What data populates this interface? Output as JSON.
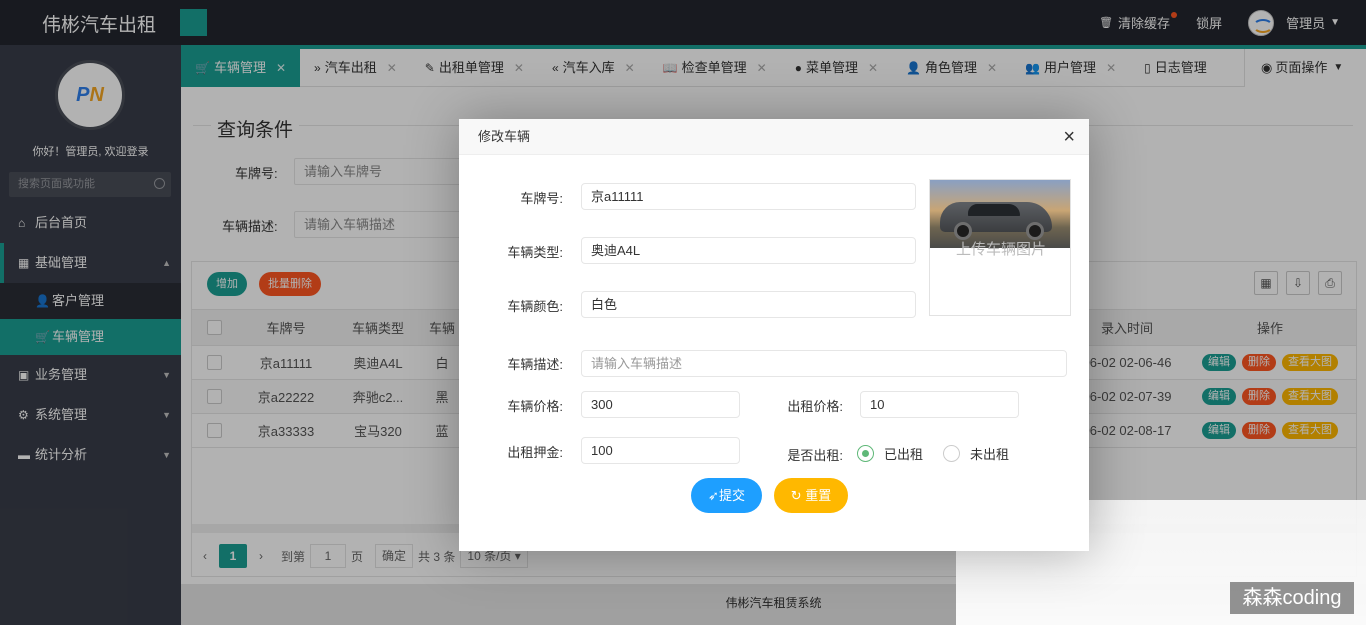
{
  "header": {
    "logo": "伟彬汽车出租",
    "clear_cache": "清除缓存",
    "lock": "锁屏",
    "user": "管理员"
  },
  "sidebar": {
    "logo_text": "PN",
    "welcome": "你好！管理员, 欢迎登录",
    "search_placeholder": "搜索页面或功能",
    "items": [
      {
        "label": "后台首页"
      },
      {
        "label": "基础管理"
      },
      {
        "label": "客户管理"
      },
      {
        "label": "车辆管理"
      },
      {
        "label": "业务管理"
      },
      {
        "label": "系统管理"
      },
      {
        "label": "统计分析"
      }
    ]
  },
  "tabs": [
    {
      "label": "车辆管理"
    },
    {
      "label": "汽车出租"
    },
    {
      "label": "出租单管理"
    },
    {
      "label": "汽车入库"
    },
    {
      "label": "检查单管理"
    },
    {
      "label": "菜单管理"
    },
    {
      "label": "角色管理"
    },
    {
      "label": "用户管理"
    },
    {
      "label": "日志管理"
    }
  ],
  "tab_ops": "页面操作",
  "query": {
    "title": "查询条件",
    "plate_label": "车牌号:",
    "plate_placeholder": "请输入车牌号",
    "desc_label": "车辆描述:",
    "desc_placeholder": "请输入车辆描述"
  },
  "table": {
    "add": "增加",
    "batch_delete": "批量删除",
    "headers": {
      "plate": "车牌号",
      "type": "车辆类型",
      "color": "车辆",
      "time": "录入时间",
      "op": "操作"
    },
    "rows": [
      {
        "plate": "京a11111",
        "type": "奥迪A4L",
        "color": "白",
        "time": "06-02 02-06-46"
      },
      {
        "plate": "京a22222",
        "type": "奔驰c2...",
        "color": "黑",
        "time": "06-02 02-07-39"
      },
      {
        "plate": "京a33333",
        "type": "宝马320",
        "color": "蓝",
        "time": "06-02 02-08-17"
      }
    ],
    "op_edit": "编辑",
    "op_delete": "删除",
    "op_view": "查看大图"
  },
  "pager": {
    "current": "1",
    "goto": "到第",
    "page_input": "1",
    "page_unit": "页",
    "confirm": "确定",
    "total": "共 3 条",
    "size": "10 条/页"
  },
  "modal": {
    "title": "修改车辆",
    "plate_label": "车牌号:",
    "plate": "京a11111",
    "type_label": "车辆类型:",
    "type": "奥迪A4L",
    "color_label": "车辆颜色:",
    "color": "白色",
    "upload_text": "上传车辆图片",
    "desc_label": "车辆描述:",
    "desc_placeholder": "请输入车辆描述",
    "price_label": "车辆价格:",
    "price": "300",
    "rent_price_label": "出租价格:",
    "rent_price": "10",
    "deposit_label": "出租押金:",
    "deposit": "100",
    "rented_label": "是否出租:",
    "opt_yes": "已出租",
    "opt_no": "未出租",
    "submit": "提交",
    "reset": "重置"
  },
  "footer": "伟彬汽车租赁系统",
  "watermark": "森森coding"
}
